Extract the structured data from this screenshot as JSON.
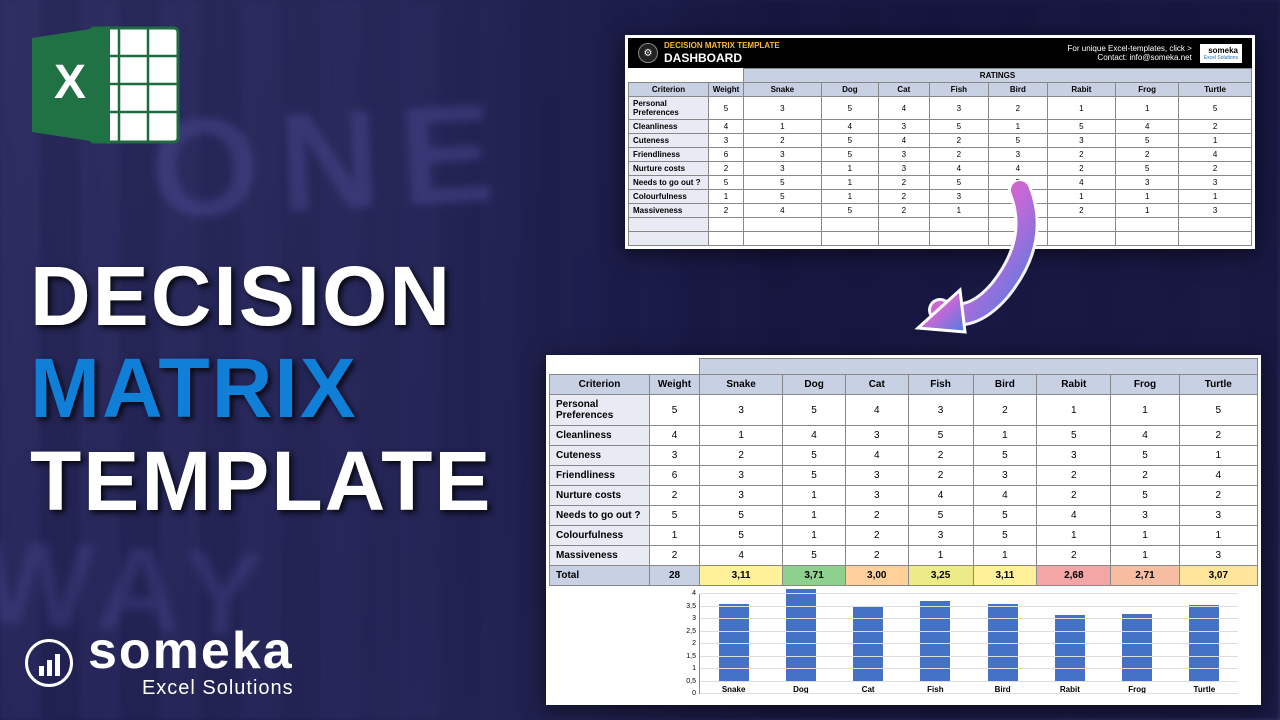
{
  "title": {
    "line1": "DECISION",
    "line2": "MATRIX",
    "line3": "TEMPLATE"
  },
  "logo": {
    "brand": "someka",
    "sub": "Excel Solutions"
  },
  "header": {
    "template_name": "DECISION MATRIX TEMPLATE",
    "dashboard": "DASHBOARD",
    "promo": "For unique Excel-templates, click >",
    "contact": "Contact: info@someka.net",
    "someka": "someka",
    "someka_sub": "Excel Solutions",
    "ratings": "RATINGS"
  },
  "columns": {
    "criterion": "Criterion",
    "weight": "Weight",
    "options": [
      "Snake",
      "Dog",
      "Cat",
      "Fish",
      "Bird",
      "Rabit",
      "Frog",
      "Turtle"
    ]
  },
  "criteria": [
    {
      "name": "Personal Preferences",
      "weight": 5,
      "vals": [
        3,
        5,
        4,
        3,
        2,
        1,
        1,
        5
      ]
    },
    {
      "name": "Cleanliness",
      "weight": 4,
      "vals": [
        1,
        4,
        3,
        5,
        1,
        5,
        4,
        2
      ]
    },
    {
      "name": "Cuteness",
      "weight": 3,
      "vals": [
        2,
        5,
        4,
        2,
        5,
        3,
        5,
        1
      ]
    },
    {
      "name": "Friendliness",
      "weight": 6,
      "vals": [
        3,
        5,
        3,
        2,
        3,
        2,
        2,
        4
      ]
    },
    {
      "name": "Nurture costs",
      "weight": 2,
      "vals": [
        3,
        1,
        3,
        4,
        4,
        2,
        5,
        2
      ]
    },
    {
      "name": "Needs to go out ?",
      "weight": 5,
      "vals": [
        5,
        1,
        2,
        5,
        5,
        4,
        3,
        3
      ]
    },
    {
      "name": "Colourfulness",
      "weight": 1,
      "vals": [
        5,
        1,
        2,
        3,
        5,
        1,
        1,
        1
      ]
    },
    {
      "name": "Massiveness",
      "weight": 2,
      "vals": [
        4,
        5,
        2,
        1,
        1,
        2,
        1,
        3
      ]
    }
  ],
  "totals": {
    "label": "Total",
    "weight": 28,
    "scores": [
      "3,11",
      "3,71",
      "3,00",
      "3,25",
      "3,11",
      "2,68",
      "2,71",
      "3,07"
    ],
    "colors": [
      "#fff09a",
      "#8ed08e",
      "#ffd09a",
      "#edea88",
      "#fff09a",
      "#f4a6a6",
      "#f7bda0",
      "#ffe59a"
    ]
  },
  "chart_data": {
    "type": "bar",
    "categories": [
      "Snake",
      "Dog",
      "Cat",
      "Fish",
      "Bird",
      "Rabit",
      "Frog",
      "Turtle"
    ],
    "values": [
      3.11,
      3.71,
      3.0,
      3.25,
      3.11,
      2.68,
      2.71,
      3.07
    ],
    "ylim": [
      0,
      4
    ],
    "yticks": [
      0,
      0.5,
      1,
      1.5,
      2,
      2.5,
      3,
      3.5,
      4
    ]
  }
}
